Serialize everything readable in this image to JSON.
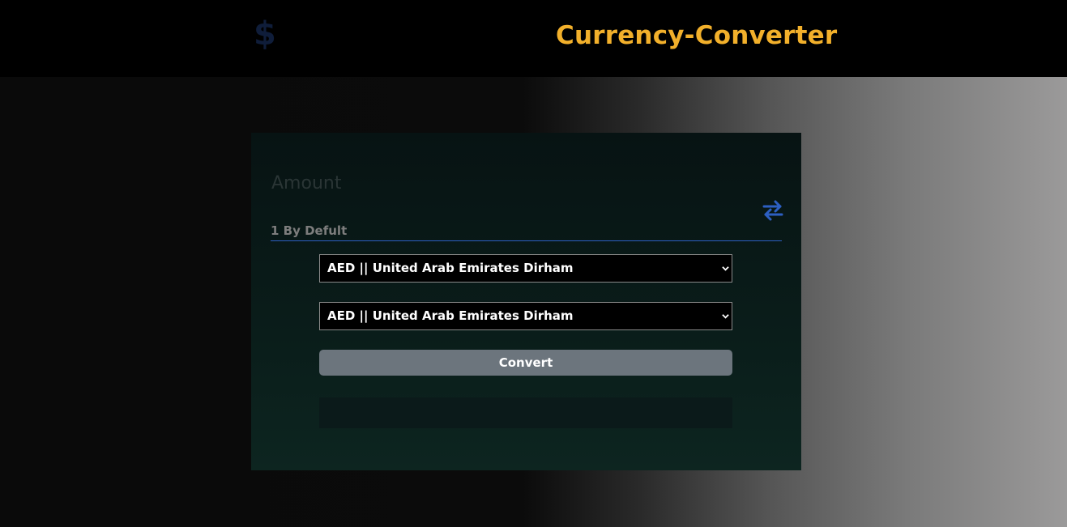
{
  "header": {
    "logo_symbol": "$",
    "title": "Currency-Converter"
  },
  "form": {
    "amount_label": "Amount",
    "amount_placeholder": "1 By Defult",
    "amount_value": "",
    "swap_icon": "swap-arrows-icon",
    "from_currency": "AED || United Arab Emirates Dirham",
    "to_currency": "AED || United Arab Emirates Dirham",
    "convert_label": "Convert",
    "result": ""
  },
  "colors": {
    "title": "#f2b02b",
    "logo": "#0f1d3a",
    "accent": "#2d5fc2",
    "button": "#6c757d"
  }
}
